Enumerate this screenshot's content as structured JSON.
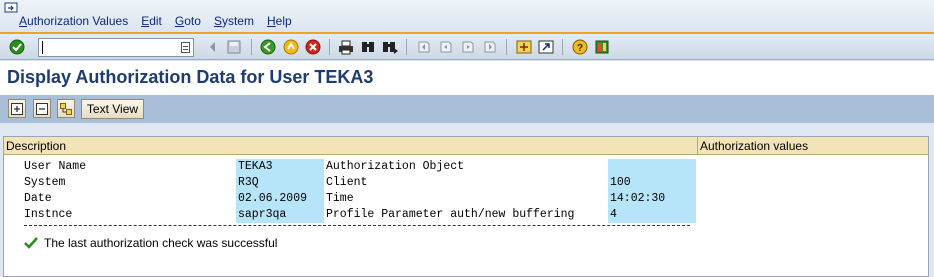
{
  "menu": [
    {
      "label": "Authorization Values"
    },
    {
      "label": "Edit"
    },
    {
      "label": "Goto"
    },
    {
      "label": "System"
    },
    {
      "label": "Help"
    }
  ],
  "toolbar": {
    "command_field_value": "",
    "icons": [
      "enter-icon",
      "back-arrow-icon",
      "save-icon",
      "back-icon",
      "exit-icon",
      "cancel-icon",
      "print-icon",
      "find-icon",
      "find-next-icon",
      "first-page-icon",
      "previous-page-icon",
      "next-page-icon",
      "last-page-icon",
      "create-session-icon",
      "shortcut-icon",
      "help-icon",
      "customize-layout-icon"
    ]
  },
  "screen_title": "Display Authorization Data for User TEKA3",
  "app_toolbar": {
    "text_view_label": "Text View",
    "icons": [
      "expand-icon",
      "collapse-icon",
      "hierarchy-icon"
    ]
  },
  "columns": {
    "description": "Description",
    "authorization_values": "Authorization values"
  },
  "rows": [
    {
      "label": "User Name",
      "value": "TEKA3",
      "label2": "Authorization Object",
      "value2": ""
    },
    {
      "label": "System",
      "value": "R3Q",
      "label2": "Client",
      "value2": "100"
    },
    {
      "label": "Date",
      "value": "02.06.2009",
      "label2": "Time",
      "value2": "14:02:30"
    },
    {
      "label": "Instnce",
      "value": "sapr3qa",
      "label2": "Profile Parameter auth/new buffering",
      "value2": "4"
    }
  ],
  "status_message": "The last authorization check was successful",
  "colors": {
    "title": "#1d3d6e",
    "highlight": "#b6e4f8",
    "header": "#f2e4b6",
    "accent_line": "#f0a12a",
    "success": "#2e8b1e"
  }
}
